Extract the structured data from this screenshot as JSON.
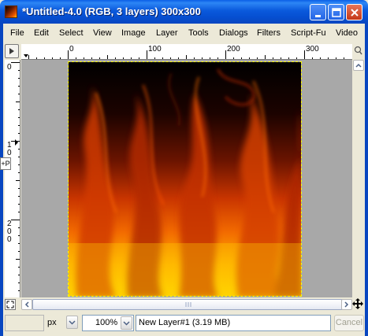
{
  "window": {
    "title": "*Untitled-4.0 (RGB, 3 layers) 300x300",
    "colors": {
      "titlebar": "#0a59dc",
      "close": "#c43818"
    }
  },
  "menu": {
    "items": [
      {
        "label": "File"
      },
      {
        "label": "Edit"
      },
      {
        "label": "Select"
      },
      {
        "label": "View"
      },
      {
        "label": "Image"
      },
      {
        "label": "Layer"
      },
      {
        "label": "Tools"
      },
      {
        "label": "Dialogs"
      },
      {
        "label": "Filters"
      },
      {
        "label": "Script-Fu"
      },
      {
        "label": "Video"
      }
    ]
  },
  "rulers": {
    "top_labels": [
      "0",
      "100",
      "200",
      "300"
    ],
    "left_labels": [
      "0",
      "1\n0",
      "2\n0\n0"
    ]
  },
  "side_tag": "+P",
  "statusbar": {
    "unit": "px",
    "zoom": "100%",
    "message": "New Layer#1 (3.19 MB)",
    "cancel_label": "Cancel"
  },
  "icons": {
    "navigate": "nav-icon",
    "move": "move-arrows-icon",
    "quickmask": "quickmask-icon"
  },
  "image": {
    "description_colors": [
      "#000000",
      "#6b1400",
      "#d43b00",
      "#ff7a00",
      "#ffd600"
    ]
  }
}
